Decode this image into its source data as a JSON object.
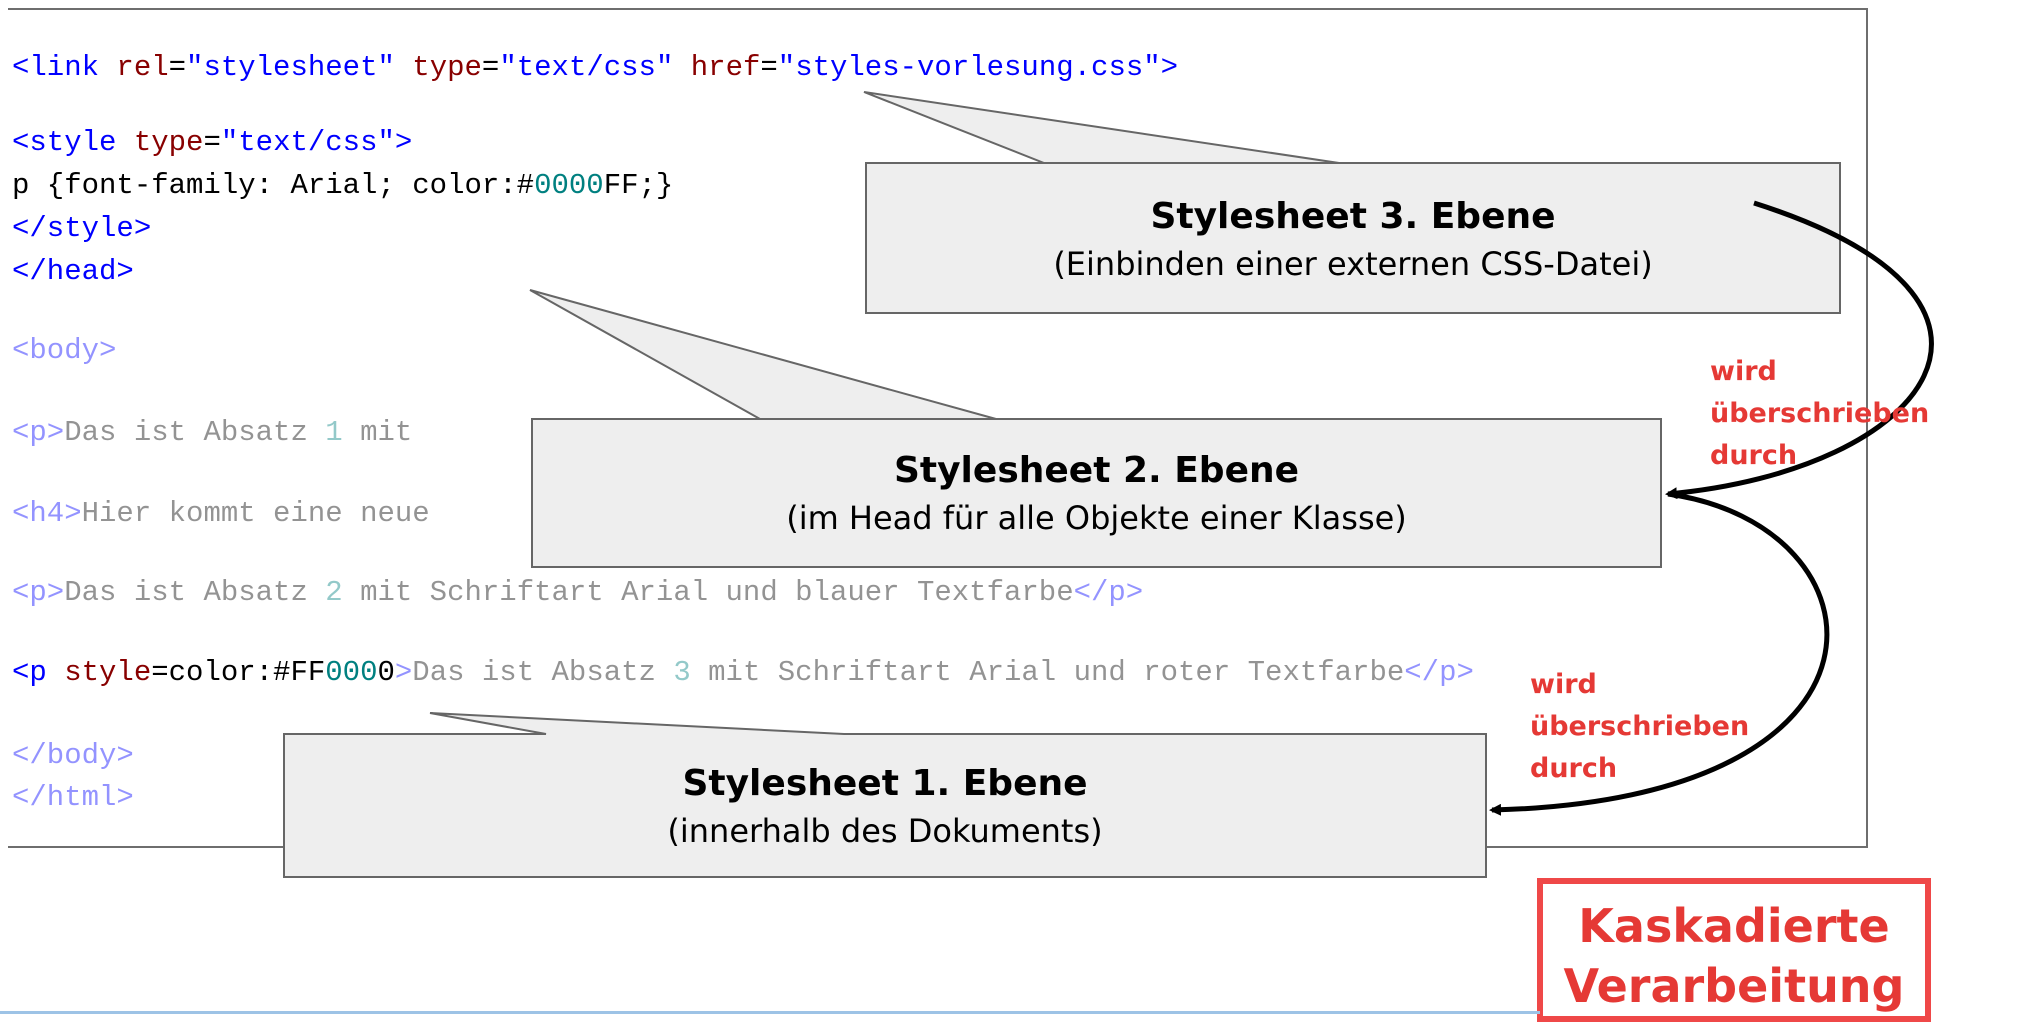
{
  "code_lines": [
    {
      "segments": [
        [
          "t",
          "<link "
        ],
        [
          "a",
          "rel"
        ],
        [
          "k",
          "="
        ],
        [
          "v",
          "\"stylesheet\" "
        ],
        [
          "a",
          "type"
        ],
        [
          "k",
          "="
        ],
        [
          "v",
          "\"text/css\" "
        ],
        [
          "a",
          "href"
        ],
        [
          "k",
          "="
        ],
        [
          "v",
          "\"styles-vorlesung.css\""
        ],
        [
          "t",
          ">"
        ]
      ]
    },
    {
      "segments": [
        [
          "t",
          "<style "
        ],
        [
          "a",
          "type"
        ],
        [
          "k",
          "="
        ],
        [
          "v",
          "\"text/css\""
        ],
        [
          "t",
          ">"
        ]
      ]
    },
    {
      "segments": [
        [
          "k",
          "p {font-family: Arial; color:#"
        ],
        [
          "n",
          "0000"
        ],
        [
          "k",
          "FF;}"
        ]
      ]
    },
    {
      "segments": [
        [
          "t",
          "</style>"
        ]
      ]
    },
    {
      "segments": [
        [
          "t",
          "</head>"
        ]
      ]
    },
    {
      "segments": [
        [
          "t",
          "<body>"
        ]
      ]
    },
    {
      "segments": [
        [
          "t",
          "<p>"
        ],
        [
          "k",
          "Das ist Absatz "
        ],
        [
          "n",
          "1"
        ],
        [
          "k",
          " mit"
        ]
      ]
    },
    {
      "segments": [
        [
          "t",
          "<h4>"
        ],
        [
          "k",
          "Hier kommt eine neue"
        ]
      ]
    },
    {
      "segments": [
        [
          "t",
          "<p>"
        ],
        [
          "k",
          "Das ist Absatz "
        ],
        [
          "n",
          "2"
        ],
        [
          "k",
          " mit Schriftart Arial und blauer Textfarbe"
        ],
        [
          "t",
          "</p>"
        ]
      ]
    },
    {
      "segments": [
        [
          "t",
          "<p "
        ],
        [
          "a",
          "style"
        ],
        [
          "k",
          "=color:#FF"
        ],
        [
          "n",
          "000"
        ],
        [
          "k",
          "0"
        ],
        [
          "t",
          ">"
        ],
        [
          "k",
          "Das ist Absatz "
        ],
        [
          "n",
          "3"
        ],
        [
          "k",
          " mit Schriftart Arial und roter Textfarbe"
        ],
        [
          "t",
          "</p>"
        ]
      ]
    },
    {
      "segments": [
        [
          "t",
          "</body>"
        ]
      ]
    },
    {
      "segments": [
        [
          "t",
          "</html>"
        ]
      ]
    }
  ],
  "boxes": {
    "level3": {
      "title": "Stylesheet 3. Ebene",
      "subtitle": "(Einbinden einer externen CSS-Datei)"
    },
    "level2": {
      "title": "Stylesheet 2. Ebene",
      "subtitle": "(im Head für alle Objekte einer Klasse)"
    },
    "level1": {
      "title": "Stylesheet 1. Ebene",
      "subtitle": "(innerhalb des Dokuments)"
    }
  },
  "arrow_labels": {
    "upper": [
      "wird",
      "überschrieben",
      "durch"
    ],
    "lower": [
      "wird",
      "überschrieben",
      "durch"
    ]
  },
  "cascade": {
    "line1": "Kaskadierte",
    "line2": "Verarbeitung"
  },
  "colors": {
    "label_red": "#e53935",
    "box_fill": "#eeeeee",
    "box_border": "#666666",
    "cascade_border": "#ef4848"
  }
}
